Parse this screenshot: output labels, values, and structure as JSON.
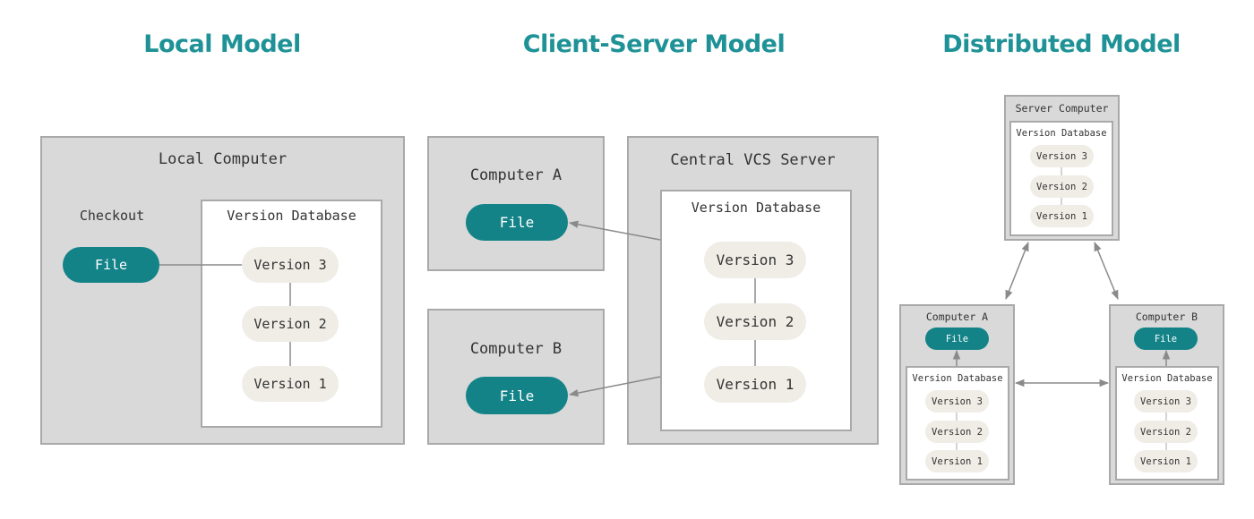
{
  "colors": {
    "accent": "#1e9296",
    "file": "#138388",
    "box": "#d9d9d9",
    "border": "#a9a9a9",
    "version": "#efede6",
    "line": "#8a8a8a"
  },
  "local": {
    "title": "Local Model",
    "computer": "Local Computer",
    "checkout": "Checkout",
    "file": "File",
    "database": "Version Database",
    "versions": [
      "Version 3",
      "Version 2",
      "Version 1"
    ]
  },
  "client_server": {
    "title": "Client-Server Model",
    "computer_a": {
      "label": "Computer A",
      "file": "File"
    },
    "computer_b": {
      "label": "Computer B",
      "file": "File"
    },
    "server": "Central VCS Server",
    "database": "Version Database",
    "versions": [
      "Version 3",
      "Version 2",
      "Version 1"
    ]
  },
  "distributed": {
    "title": "Distributed Model",
    "server": {
      "label": "Server Computer",
      "database": "Version Database",
      "versions": [
        "Version 3",
        "Version 2",
        "Version 1"
      ]
    },
    "computer_a": {
      "label": "Computer A",
      "file": "File",
      "database": "Version Database",
      "versions": [
        "Version 3",
        "Version 2",
        "Version 1"
      ]
    },
    "computer_b": {
      "label": "Computer B",
      "file": "File",
      "database": "Version Database",
      "versions": [
        "Version 3",
        "Version 2",
        "Version 1"
      ]
    }
  }
}
